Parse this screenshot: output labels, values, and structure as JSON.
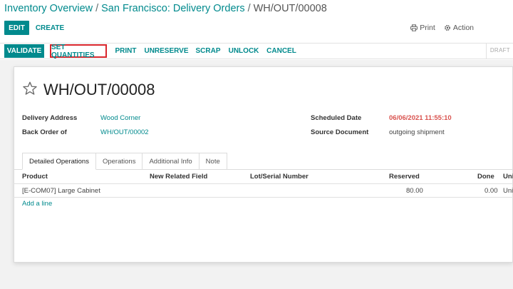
{
  "breadcrumb": {
    "items": [
      {
        "label": "Inventory Overview"
      },
      {
        "label": "San Francisco: Delivery Orders"
      }
    ],
    "separator": "/",
    "current": "WH/OUT/00008"
  },
  "control_panel": {
    "edit_label": "EDIT",
    "create_label": "CREATE",
    "print_label": "Print",
    "action_label": "Action"
  },
  "statusbar": {
    "validate_label": "VALIDATE",
    "set_quantities_label": "SET QUANTITIES",
    "print_label": "PRINT",
    "unreserve_label": "UNRESERVE",
    "scrap_label": "SCRAP",
    "unlock_label": "UNLOCK",
    "cancel_label": "CANCEL",
    "state_label": "DRAFT"
  },
  "record": {
    "title": "WH/OUT/00008",
    "fields": {
      "delivery_address_label": "Delivery Address",
      "delivery_address_value": "Wood Corner",
      "back_order_label": "Back Order of",
      "back_order_value": "WH/OUT/00002",
      "scheduled_date_label": "Scheduled Date",
      "scheduled_date_value": "06/06/2021 11:55:10",
      "source_document_label": "Source Document",
      "source_document_value": "outgoing shipment"
    }
  },
  "tabs": [
    "Detailed Operations",
    "Operations",
    "Additional Info",
    "Note"
  ],
  "table": {
    "columns": [
      "Product",
      "New Related Field",
      "Lot/Serial Number",
      "Reserved",
      "Done",
      "Uni"
    ],
    "rows": [
      {
        "product": "[E-COM07] Large Cabinet",
        "reserved": "80.00",
        "done": "0.00",
        "unit": "Uni"
      }
    ],
    "add_line_label": "Add a line"
  },
  "colors": {
    "accent": "#018a8d",
    "highlight": "#d9262c",
    "date_red": "#d9534f"
  },
  "icons": {
    "print": "printer-icon",
    "action": "gear-icon",
    "favorite": "star-outline-icon"
  }
}
